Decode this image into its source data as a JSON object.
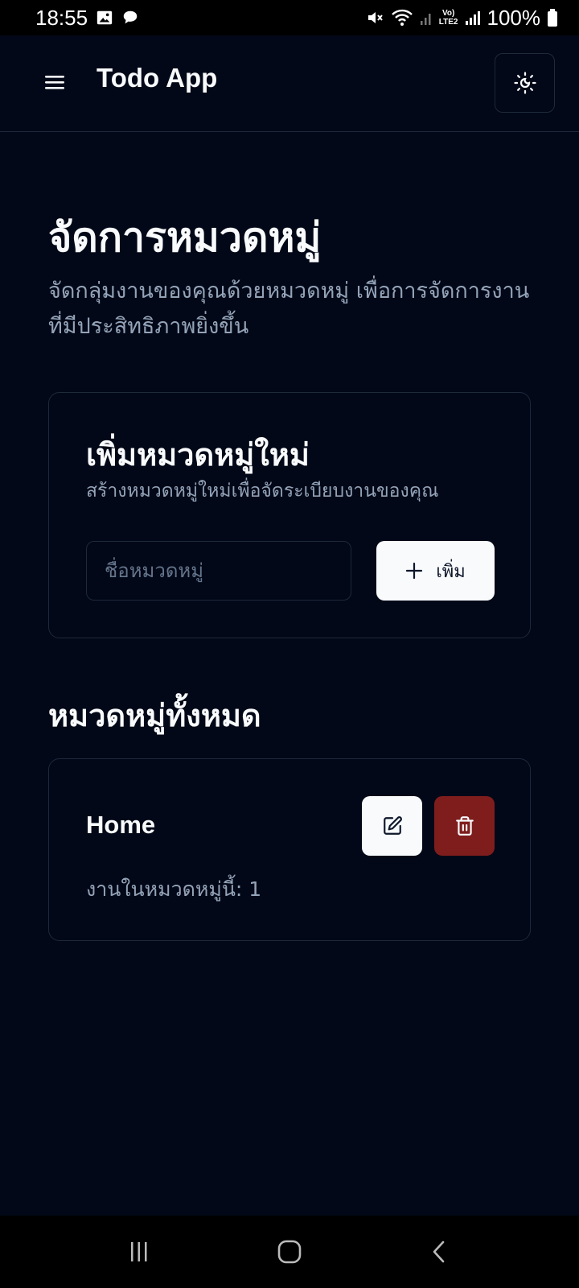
{
  "status_bar": {
    "time": "18:55",
    "battery": "100%",
    "network": "LTE2"
  },
  "app_bar": {
    "title": "Todo App",
    "menu_icon": "hamburger-menu-icon",
    "theme_icon": "sun-moon-icon"
  },
  "page": {
    "title": "จัดการหมวดหมู่",
    "description": "จัดกลุ่มงานของคุณด้วยหมวดหมู่ เพื่อการจัดการงานที่มีประสิทธิภาพยิ่งขึ้น"
  },
  "add_category": {
    "title": "เพิ่มหมวดหมู่ใหม่",
    "subtitle": "สร้างหมวดหมู่ใหม่เพื่อจัดระเบียบงานของคุณ",
    "input_placeholder": "ชื่อหมวดหมู่",
    "input_value": "",
    "add_label": "เพิ่ม"
  },
  "categories_section": {
    "title": "หมวดหมู่ทั้งหมด",
    "items": [
      {
        "name": "Home",
        "count_text": "งานในหมวดหมู่นี้: 1"
      }
    ]
  },
  "colors": {
    "background": "#020817",
    "border": "#1e293b",
    "muted_text": "#94a3b8",
    "primary_button": "#f8fafc",
    "destructive": "#7f1d1d"
  }
}
